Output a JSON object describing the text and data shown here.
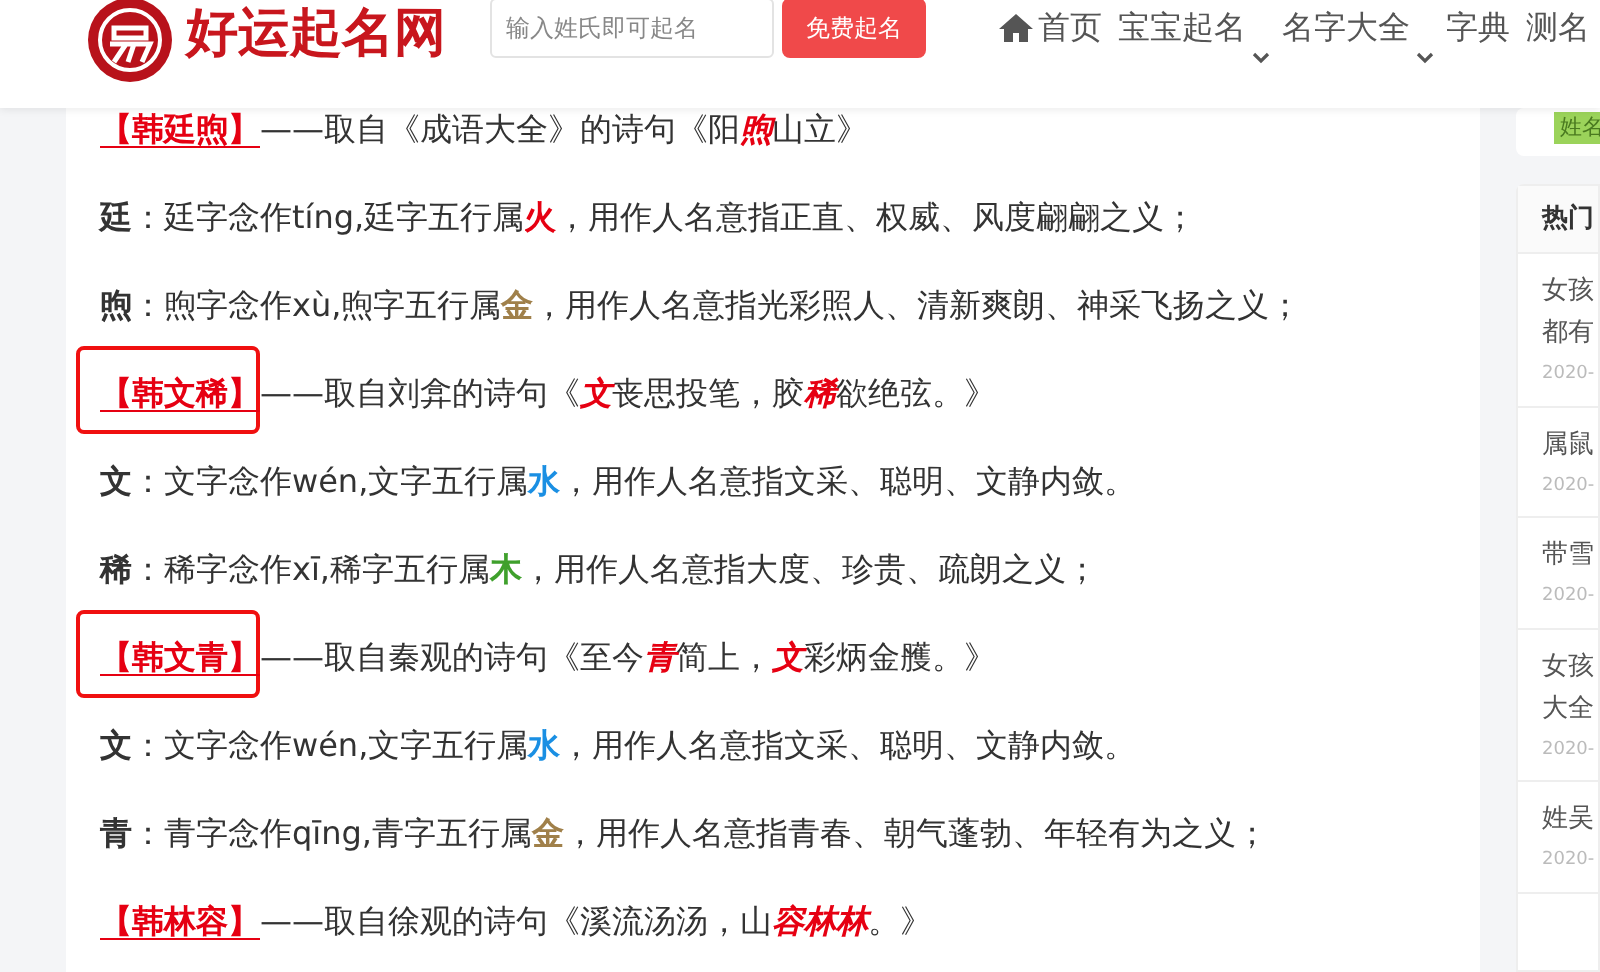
{
  "header": {
    "logo_text": "好运起名网",
    "search": {
      "placeholder": "输入姓氏即可起名"
    },
    "search_button": "免费起名",
    "nav": [
      {
        "label": "首页",
        "kind": "home"
      },
      {
        "label": "宝宝起名",
        "kind": "dropdown"
      },
      {
        "label": "名字大全",
        "kind": "dropdown"
      },
      {
        "label": "字典",
        "kind": "plain"
      },
      {
        "label": "测名",
        "kind": "plain"
      }
    ]
  },
  "article": [
    {
      "kind": "title",
      "name": "【韩廷煦】",
      "highlighted": false,
      "segments": [
        {
          "text": "——取自《成语大全》的诗句《阳",
          "emph": false
        },
        {
          "text": "煦",
          "emph": true
        },
        {
          "text": "山立》",
          "emph": false
        }
      ]
    },
    {
      "kind": "meaning",
      "char": "廷",
      "before": "：廷字念作tíng,廷字五行属",
      "element": "火",
      "color": "#e60012",
      "after": "，用作人名意指正直、权威、风度翩翩之义；"
    },
    {
      "kind": "meaning",
      "char": "煦",
      "before": "：煦字念作xù,煦字五行属",
      "element": "金",
      "color": "#a0804a",
      "after": "，用作人名意指光彩照人、清新爽朗、神采飞扬之义；"
    },
    {
      "kind": "title",
      "name": "【韩文稀】",
      "highlighted": true,
      "segments": [
        {
          "text": "——取自刘弇的诗句《",
          "emph": false
        },
        {
          "text": "文",
          "emph": true
        },
        {
          "text": "丧思投笔，胶",
          "emph": false
        },
        {
          "text": "稀",
          "emph": true
        },
        {
          "text": "欲绝弦。》",
          "emph": false
        }
      ]
    },
    {
      "kind": "meaning",
      "char": "文",
      "before": "：文字念作wén,文字五行属",
      "element": "水",
      "color": "#1a8fe3",
      "after": "，用作人名意指文采、聪明、文静内敛。"
    },
    {
      "kind": "meaning",
      "char": "稀",
      "before": "：稀字念作xī,稀字五行属",
      "element": "木",
      "color": "#3fa02c",
      "after": "，用作人名意指大度、珍贵、疏朗之义；"
    },
    {
      "kind": "title",
      "name": "【韩文青】",
      "highlighted": true,
      "segments": [
        {
          "text": "——取自秦观的诗句《至今",
          "emph": false
        },
        {
          "text": "青",
          "emph": true
        },
        {
          "text": "简上，",
          "emph": false
        },
        {
          "text": "文",
          "emph": true
        },
        {
          "text": "彩炳金雘。》",
          "emph": false
        }
      ]
    },
    {
      "kind": "meaning",
      "char": "文",
      "before": "：文字念作wén,文字五行属",
      "element": "水",
      "color": "#1a8fe3",
      "after": "，用作人名意指文采、聪明、文静内敛。"
    },
    {
      "kind": "meaning",
      "char": "青",
      "before": "：青字念作qīng,青字五行属",
      "element": "金",
      "color": "#a0804a",
      "after": "，用作人名意指青春、朝气蓬勃、年轻有为之义；"
    },
    {
      "kind": "title",
      "name": "【韩林容】",
      "highlighted": false,
      "segments": [
        {
          "text": "——取自徐观的诗句《溪流汤汤，山",
          "emph": false
        },
        {
          "text": "容林林",
          "emph": true
        },
        {
          "text": "。》",
          "emph": false
        }
      ]
    }
  ],
  "sidebar": {
    "tag": "姓名",
    "hot_title": "热门",
    "hot_items": [
      {
        "lines": [
          "女孩",
          "都有"
        ],
        "date": "2020-"
      },
      {
        "lines": [
          "属鼠"
        ],
        "date": "2020-"
      },
      {
        "lines": [
          "带雪"
        ],
        "date": "2020-"
      },
      {
        "lines": [
          "女孩",
          "大全"
        ],
        "date": "2020-"
      },
      {
        "lines": [
          "姓吴"
        ],
        "date": "2020-"
      }
    ]
  }
}
